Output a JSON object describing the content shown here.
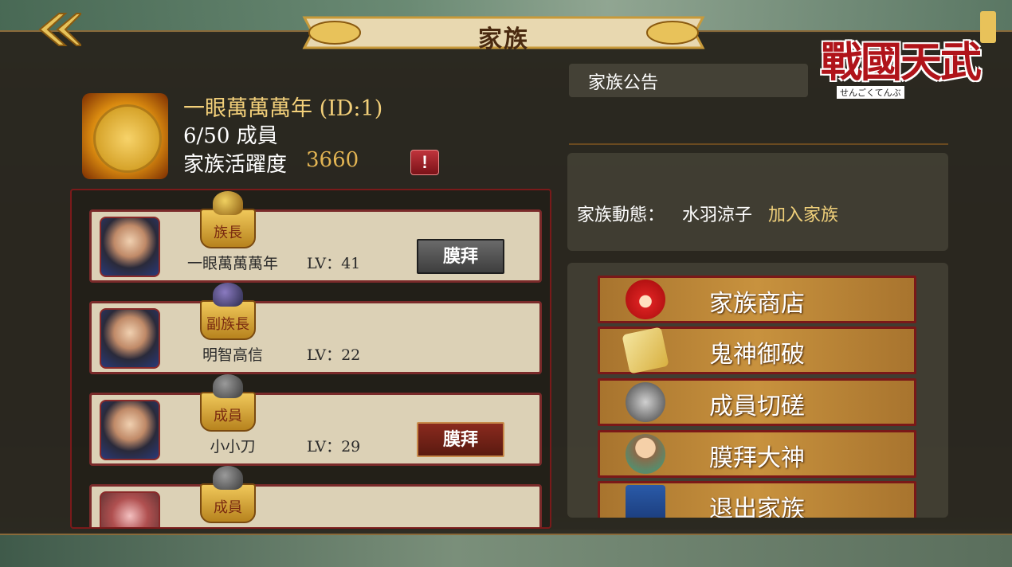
{
  "header": {
    "title": "家族",
    "logo_text": "戰國天武",
    "logo_sub": "せんごくてんぶ"
  },
  "family": {
    "name": "一眼萬萬萬年 (ID:1)",
    "members": "6/50  成員",
    "activity_label": "家族活躍度",
    "activity_value": "3660",
    "alert": "!"
  },
  "members": [
    {
      "rank": "族長",
      "name": "一眼萬萬萬年",
      "level": "LV：41",
      "worship": "膜拜",
      "worship_style": "grey"
    },
    {
      "rank": "副族長",
      "name": "明智高信",
      "level": "LV：22",
      "worship": "",
      "worship_style": ""
    },
    {
      "rank": "成員",
      "name": "小小刀",
      "level": "LV：29",
      "worship": "膜拜",
      "worship_style": "red"
    },
    {
      "rank": "成員",
      "name": "",
      "level": "",
      "worship": "",
      "worship_style": ""
    }
  ],
  "notice": {
    "label": "家族公告"
  },
  "dynamics": {
    "label": "家族動態：",
    "member": "水羽涼子",
    "action": "加入家族"
  },
  "menu": [
    {
      "label": "家族商店",
      "icon": "daruma-icon"
    },
    {
      "label": "鬼神御破",
      "icon": "scroll-icon"
    },
    {
      "label": "成員切磋",
      "icon": "crossed-swords-icon"
    },
    {
      "label": "膜拜大神",
      "icon": "monk-icon"
    },
    {
      "label": "退出家族",
      "icon": "flag-icon"
    }
  ],
  "colors": {
    "gold_text": "#f3d07a",
    "activity_value": "#e2b453",
    "card_border": "#7a2a2a",
    "menu_button": "#c8923e"
  }
}
